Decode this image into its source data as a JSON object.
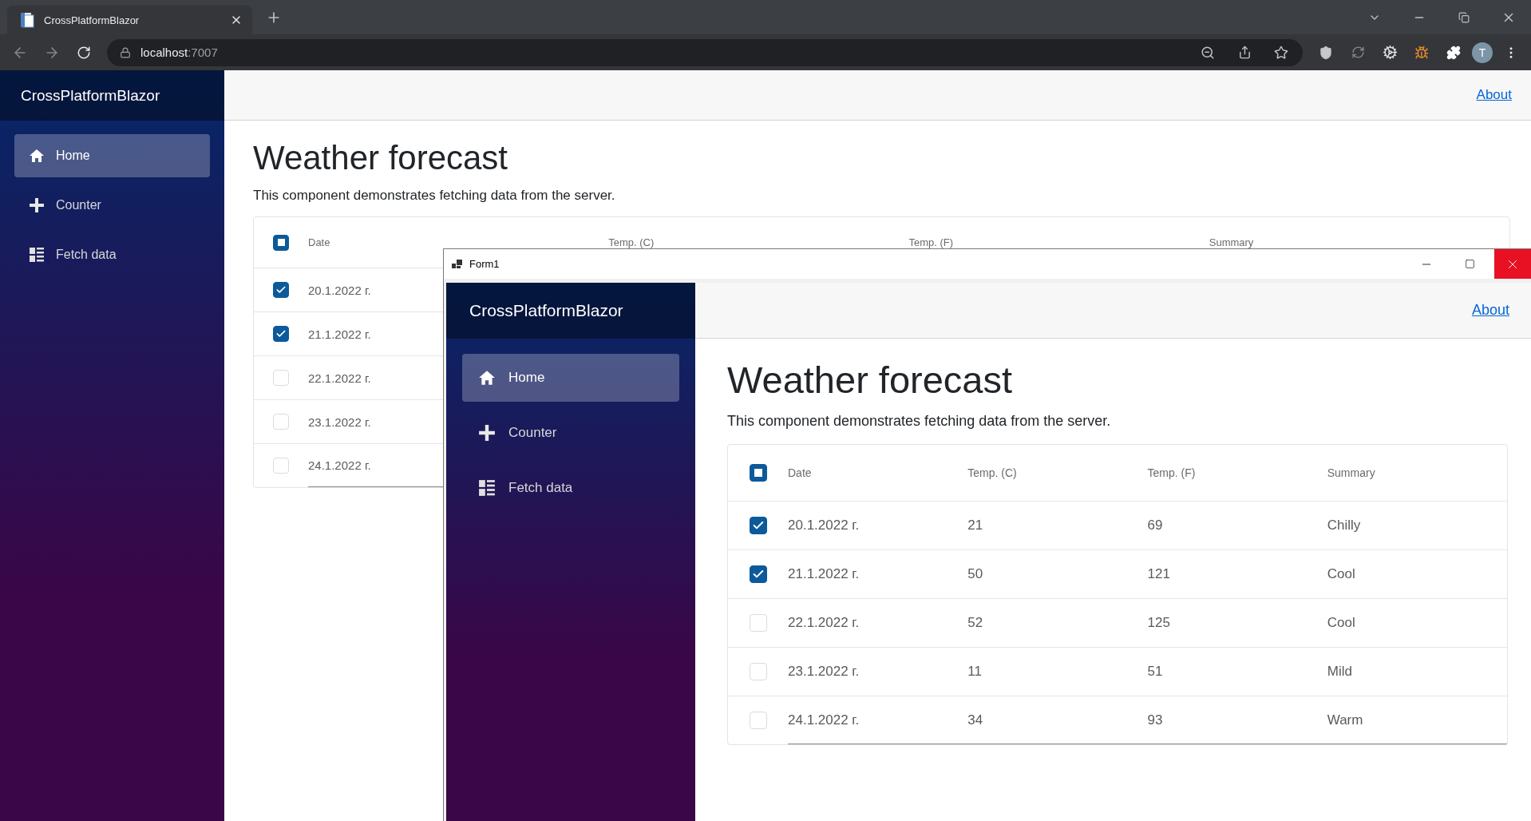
{
  "browser": {
    "tab_title": "CrossPlatformBlazor",
    "url_host": "localhost",
    "url_port": ":7007",
    "avatar": "T"
  },
  "app": {
    "brand": "CrossPlatformBlazor",
    "about": "About",
    "heading": "Weather forecast",
    "description": "This component demonstrates fetching data from the server.",
    "nav": [
      {
        "label": "Home",
        "kind": "home",
        "selected": true
      },
      {
        "label": "Counter",
        "kind": "plus",
        "selected": false
      },
      {
        "label": "Fetch data",
        "kind": "list",
        "selected": false
      }
    ],
    "table": {
      "select_all": {
        "indeterminate": true
      },
      "columns": [
        "Date",
        "Temp. (C)",
        "Temp. (F)",
        "Summary"
      ],
      "rows": [
        {
          "checked": true,
          "cells": [
            "20.1.2022 г."
          ]
        },
        {
          "checked": true,
          "cells": [
            "21.1.2022 г."
          ]
        },
        {
          "checked": false,
          "cells": [
            "22.1.2022 г."
          ]
        },
        {
          "checked": false,
          "cells": [
            "23.1.2022 г."
          ]
        },
        {
          "checked": false,
          "cells": [
            "24.1.2022 г."
          ]
        }
      ]
    }
  },
  "window": {
    "title": "Form1",
    "app": {
      "brand": "CrossPlatformBlazor",
      "about": "About",
      "heading": "Weather forecast",
      "description": "This component demonstrates fetching data from the server.",
      "nav": [
        {
          "label": "Home",
          "kind": "home",
          "selected": true
        },
        {
          "label": "Counter",
          "kind": "plus",
          "selected": false
        },
        {
          "label": "Fetch data",
          "kind": "list",
          "selected": false
        }
      ],
      "table": {
        "select_all": {
          "indeterminate": true
        },
        "columns": [
          "Date",
          "Temp. (C)",
          "Temp. (F)",
          "Summary"
        ],
        "rows": [
          {
            "checked": true,
            "cells": [
              "20.1.2022 г.",
              "21",
              "69",
              "Chilly"
            ]
          },
          {
            "checked": true,
            "cells": [
              "21.1.2022 г.",
              "50",
              "121",
              "Cool"
            ]
          },
          {
            "checked": false,
            "cells": [
              "22.1.2022 г.",
              "52",
              "125",
              "Cool"
            ]
          },
          {
            "checked": false,
            "cells": [
              "23.1.2022 г.",
              "11",
              "51",
              "Mild"
            ]
          },
          {
            "checked": false,
            "cells": [
              "24.1.2022 г.",
              "34",
              "93",
              "Warm"
            ]
          }
        ]
      }
    }
  }
}
